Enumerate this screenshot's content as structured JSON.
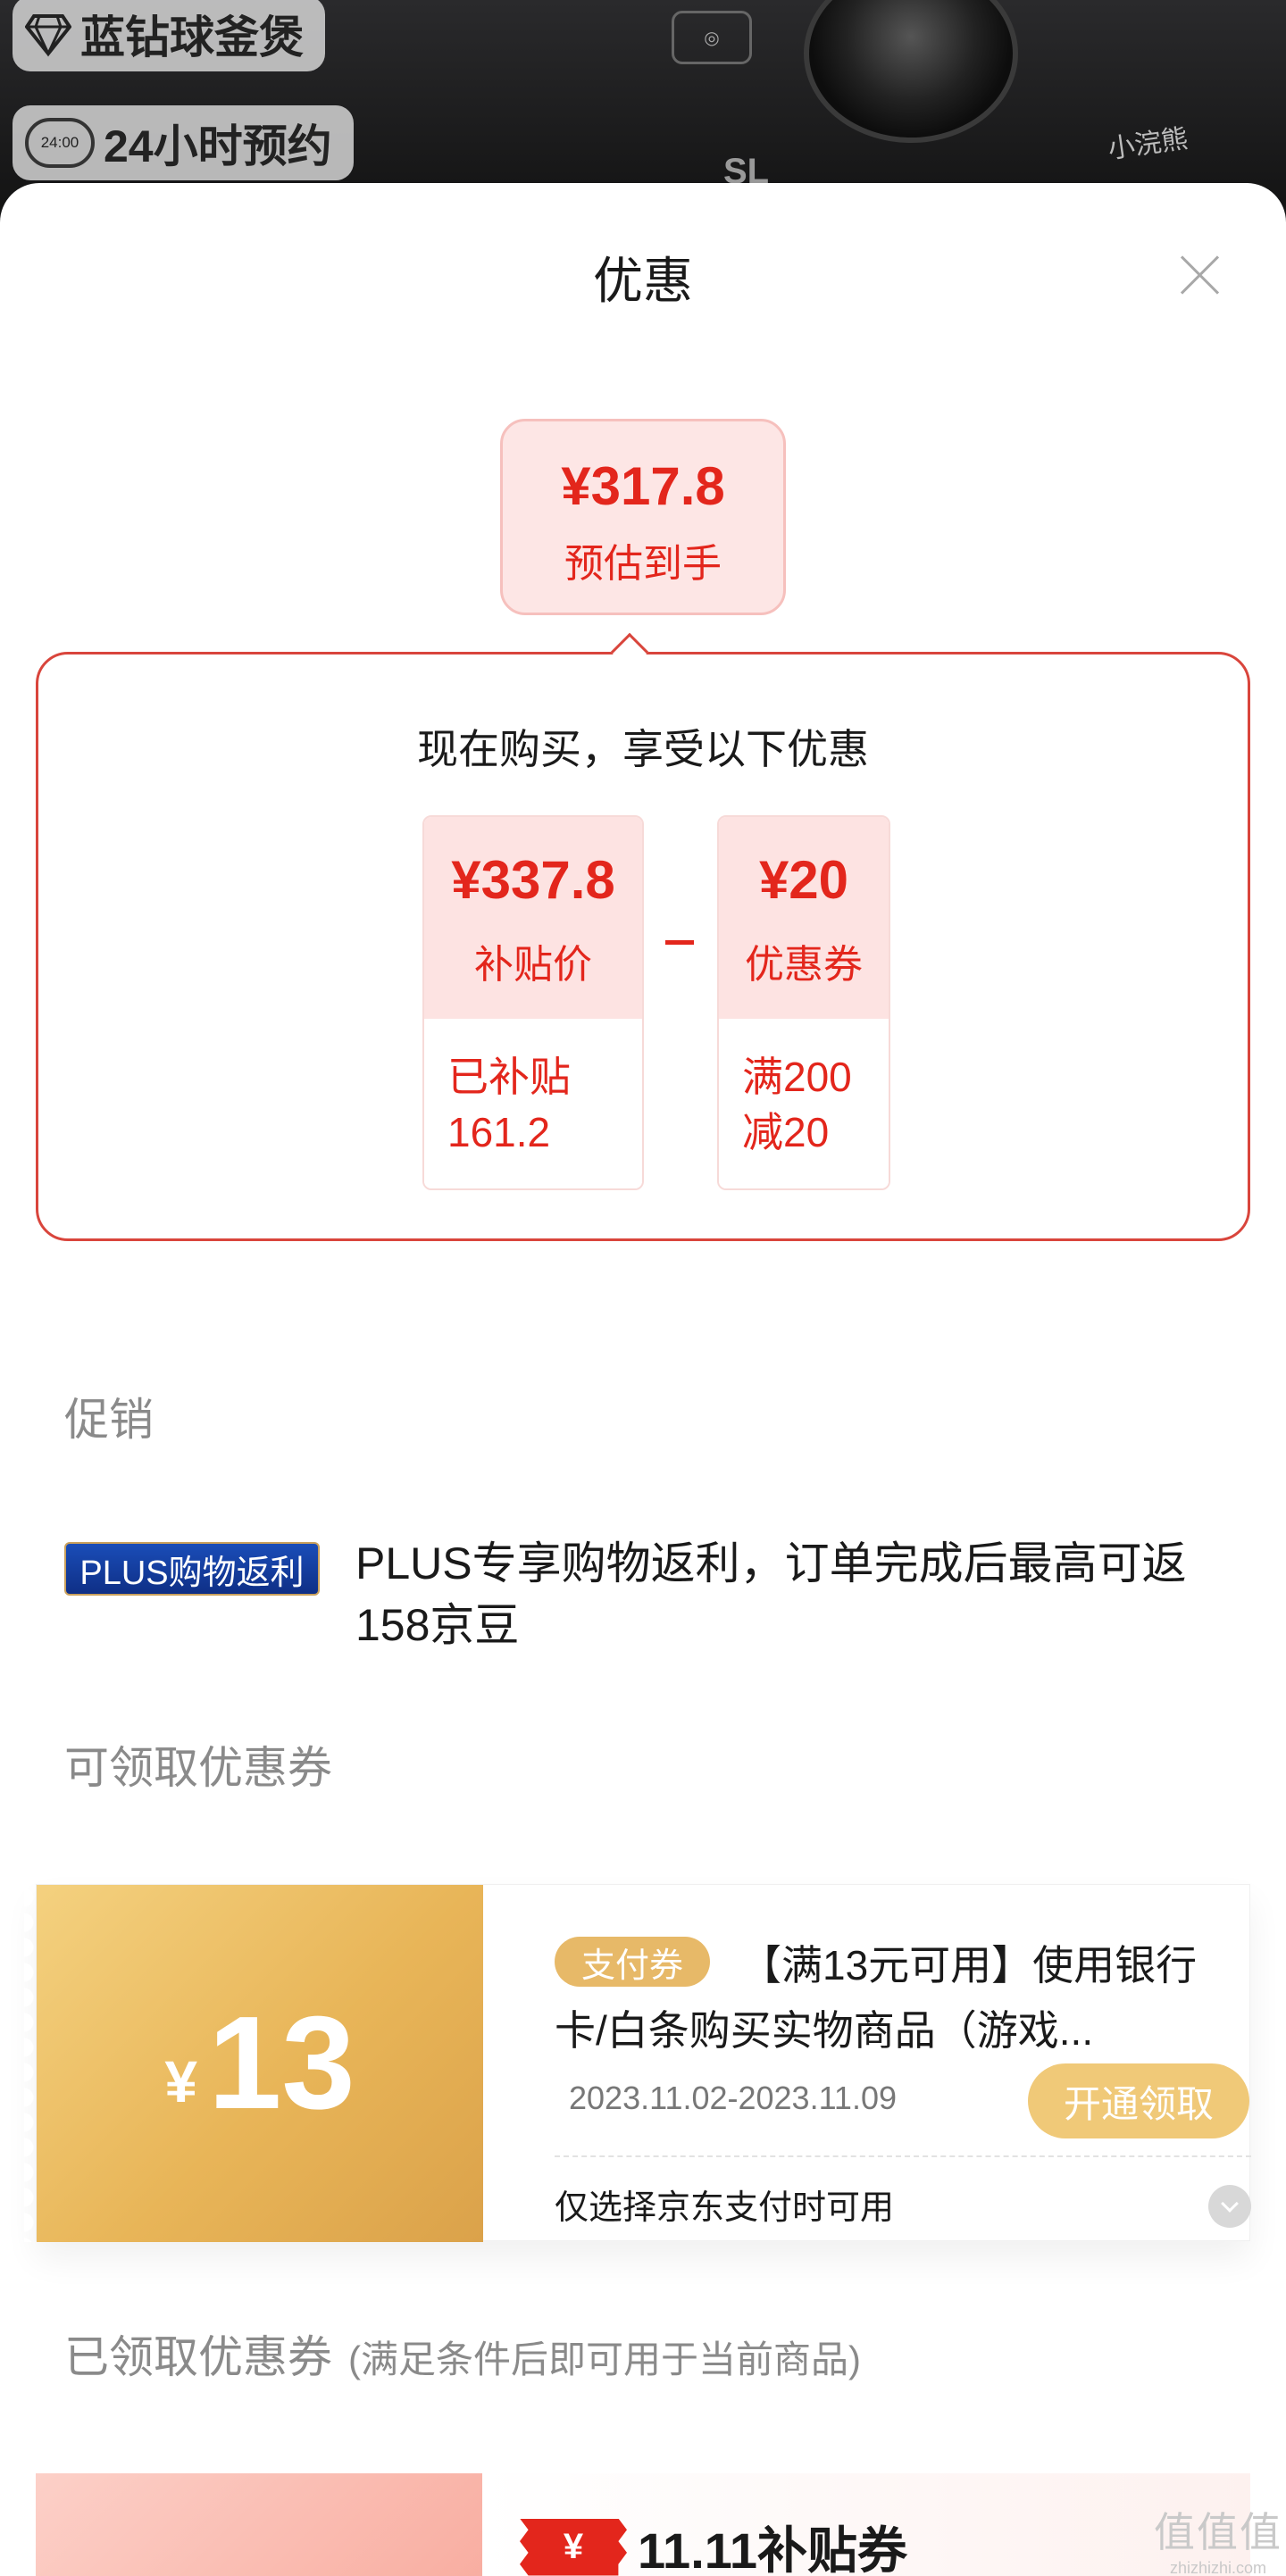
{
  "background": {
    "tag1": "蓝钻球釜煲",
    "tag2": "24小时预约",
    "clock_text": "24:00"
  },
  "sheet": {
    "title": "优惠"
  },
  "estimate": {
    "price": "¥317.8",
    "label": "预估到手"
  },
  "breakdown": {
    "title": "现在购买，享受以下优惠",
    "subsidy": {
      "amount": "¥337.8",
      "caption": "补贴价",
      "detail_line1": "已补贴",
      "detail_line2": "161.2"
    },
    "coupon": {
      "amount": "¥20",
      "caption": "优惠券",
      "detail_line1": "满200",
      "detail_line2": "减20"
    }
  },
  "promotion": {
    "heading": "促销",
    "badge": "PLUS购物返利",
    "text": "PLUS专享购物返利，订单完成后最高可返158京豆"
  },
  "available_coupons": {
    "heading": "可领取优惠券",
    "items": [
      {
        "yen": "¥",
        "value": "13",
        "type_badge": "支付券",
        "description": "【满13元可用】使用银行卡/白条购买实物商品（游戏...",
        "date_range": "2023.11.02-2023.11.09",
        "button": "开通领取",
        "note": "仅选择京东支付时可用"
      }
    ]
  },
  "claimed_coupons": {
    "heading": "已领取优惠券",
    "subheading": "(满足条件后即可用于当前商品)",
    "items": [
      {
        "badge": "¥",
        "title": "11.11补贴券"
      }
    ]
  },
  "watermark": {
    "text": "值值值",
    "domain": "zhizhizhi.com"
  },
  "colors": {
    "accent_red": "#e3261c",
    "gold": "#e7b968",
    "plus_blue": "#1a4db8"
  }
}
